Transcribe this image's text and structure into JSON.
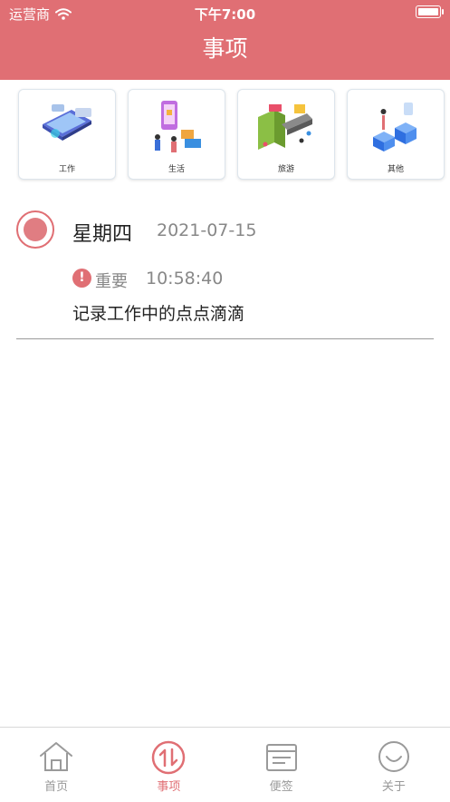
{
  "status_bar": {
    "carrier": "运营商",
    "time": "下午7:00",
    "battery_level": 1.0
  },
  "header": {
    "title": "事项"
  },
  "categories": [
    {
      "label": "工作",
      "icon": "work-illustration-icon"
    },
    {
      "label": "生活",
      "icon": "life-illustration-icon"
    },
    {
      "label": "旅游",
      "icon": "travel-illustration-icon"
    },
    {
      "label": "其他",
      "icon": "other-illustration-icon"
    }
  ],
  "entry": {
    "weekday": "星期四",
    "date": "2021-07-15",
    "priority_icon": "!",
    "priority": "重要",
    "time": "10:58:40",
    "content": "记录工作中的点点滴滴"
  },
  "tabs": [
    {
      "label": "首页",
      "icon": "home-icon",
      "active": false
    },
    {
      "label": "事项",
      "icon": "transfer-icon",
      "active": true
    },
    {
      "label": "便签",
      "icon": "note-icon",
      "active": false
    },
    {
      "label": "关于",
      "icon": "smile-icon",
      "active": false
    }
  ],
  "colors": {
    "accent": "#e06f74",
    "text_secondary": "#888888",
    "tab_inactive": "#999999"
  }
}
